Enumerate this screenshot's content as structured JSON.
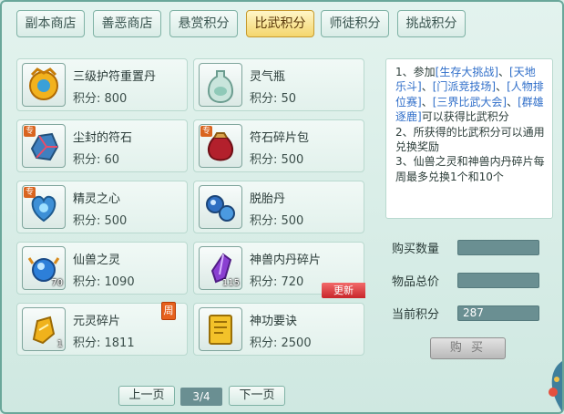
{
  "tabs": [
    {
      "label": "副本商店",
      "active": false
    },
    {
      "label": "善恶商店",
      "active": false
    },
    {
      "label": "悬赏积分",
      "active": false
    },
    {
      "label": "比武积分",
      "active": true
    },
    {
      "label": "师徒积分",
      "active": false
    },
    {
      "label": "挑战积分",
      "active": false
    }
  ],
  "items": [
    {
      "name": "三级护符重置丹",
      "price": "积分: 800",
      "icon": "golden-amulet-pill-icon"
    },
    {
      "name": "灵气瓶",
      "price": "积分: 50",
      "icon": "jade-vase-icon"
    },
    {
      "name": "尘封的符石",
      "price": "积分: 60",
      "icon": "rune-stone-icon",
      "tag": "专"
    },
    {
      "name": "符石碎片包",
      "price": "积分: 500",
      "icon": "rune-shard-bag-icon",
      "tag": "专"
    },
    {
      "name": "精灵之心",
      "price": "积分: 500",
      "icon": "spirit-heart-icon",
      "tag": "专"
    },
    {
      "name": "脱胎丹",
      "price": "积分: 500",
      "icon": "reborn-pill-icon"
    },
    {
      "name": "仙兽之灵",
      "price": "积分: 1090",
      "icon": "beast-spirit-orb-icon",
      "count": "70"
    },
    {
      "name": "神兽内丹碎片",
      "price": "积分: 720",
      "icon": "crystal-shard-icon",
      "count": "115",
      "badge": "更新"
    },
    {
      "name": "元灵碎片",
      "price": "积分: 1811",
      "icon": "yuanling-shard-icon",
      "count": "1",
      "weekly": "周"
    },
    {
      "name": "神功要诀",
      "price": "积分: 2500",
      "icon": "skill-book-icon"
    }
  ],
  "info": {
    "line1_pre": "1、参加",
    "link1": "[生存大挑战]",
    "sep1": "、",
    "link2": "[天地乐斗]",
    "sep2": "、",
    "link3": "[门派竞技场]",
    "sep3": "、",
    "link4": "[人物排位赛]",
    "sep4": "、",
    "link5": "[三界比武大会]",
    "sep5": "、",
    "link6": "[群雄逐鹿]",
    "line1_post": "可以获得比武积分",
    "line2": "2、所获得的比武积分可以通用兑换奖励",
    "line3": "3、仙兽之灵和神兽内丹碎片每周最多兑换1个和10个"
  },
  "form": {
    "qty_label": "购买数量",
    "qty_value": "",
    "total_label": "物品总价",
    "total_value": "",
    "points_label": "当前积分",
    "points_value": "287"
  },
  "buy_button": "购 买",
  "pagination": {
    "prev": "上一页",
    "page": "3/4",
    "next": "下一页"
  }
}
